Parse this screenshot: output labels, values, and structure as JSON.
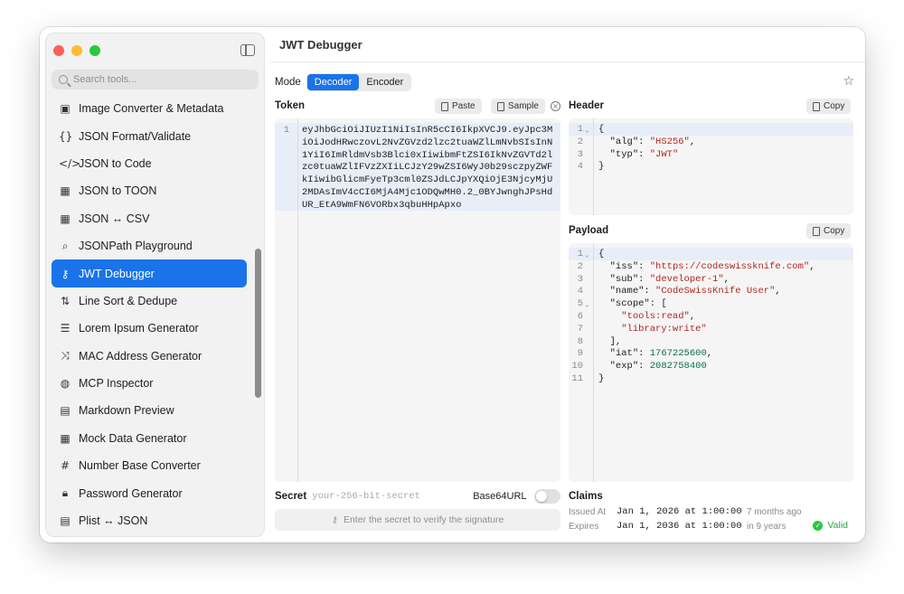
{
  "window": {
    "title": "JWT Debugger"
  },
  "sidebar": {
    "search_placeholder": "Search tools...",
    "items": [
      {
        "label": "Image Converter & Metadata",
        "icon": "image-icon",
        "glyph": "▣"
      },
      {
        "label": "JSON Format/Validate",
        "icon": "braces-icon",
        "glyph": "{}"
      },
      {
        "label": "JSON to Code",
        "icon": "code-icon",
        "glyph": "</>"
      },
      {
        "label": "JSON to TOON",
        "icon": "table-icon",
        "glyph": "▦"
      },
      {
        "label": "JSON ↔ CSV",
        "icon": "table-icon",
        "glyph": "▦"
      },
      {
        "label": "JSONPath Playground",
        "icon": "magnifier-icon",
        "glyph": "⌕"
      },
      {
        "label": "JWT Debugger",
        "icon": "key-icon",
        "glyph": "⚷"
      },
      {
        "label": "Line Sort & Dedupe",
        "icon": "sort-arrows-icon",
        "glyph": "⇅"
      },
      {
        "label": "Lorem Ipsum Generator",
        "icon": "text-lines-icon",
        "glyph": "☰"
      },
      {
        "label": "MAC Address Generator",
        "icon": "shuffle-icon",
        "glyph": "⤨"
      },
      {
        "label": "MCP Inspector",
        "icon": "globe-icon",
        "glyph": "◍"
      },
      {
        "label": "Markdown Preview",
        "icon": "document-icon",
        "glyph": "▤"
      },
      {
        "label": "Mock Data Generator",
        "icon": "table-icon",
        "glyph": "▦"
      },
      {
        "label": "Number Base Converter",
        "icon": "hash-icon",
        "glyph": "#"
      },
      {
        "label": "Password Generator",
        "icon": "lock-icon",
        "glyph": "🔒︎"
      },
      {
        "label": "Plist ↔ JSON",
        "icon": "list-icon",
        "glyph": "▤"
      }
    ]
  },
  "mode": {
    "label": "Mode",
    "options": [
      "Decoder",
      "Encoder"
    ],
    "selected": "Decoder"
  },
  "token": {
    "label": "Token",
    "paste_label": "Paste",
    "sample_label": "Sample",
    "line_number": "1",
    "value": "eyJhbGciOiJIUzI1NiIsInR5cCI6IkpXVCJ9.eyJpc3MiOiJodHRwczovL2NvZGVzd2lzc2tuaWZlLmNvbSIsInN1YiI6ImRldmVsb3Blci0xIiwibmFtZSI6IkNvZGVTd2lzc0tuaWZlIFVzZXIiLCJzY29wZSI6WyJ0b29sczpyZWFkIiwibGlicmFyeTp3cml0ZSJdLCJpYXQiOjE3NjcyMjU2MDAsImV4cCI6MjA4Mjc1ODQwMH0.2_0BYJwnghJPsHdUR_EtA9WmFN6VORbx3qbuHHpApxo"
  },
  "header": {
    "label": "Header",
    "copy_label": "Copy",
    "lines": [
      "{",
      "  \"alg\": \"HS256\",",
      "  \"typ\": \"JWT\"",
      "}"
    ]
  },
  "payload": {
    "label": "Payload",
    "copy_label": "Copy",
    "lines": [
      "{",
      "  \"iss\": \"https://codeswissknife.com\",",
      "  \"sub\": \"developer-1\",",
      "  \"name\": \"CodeSwissKnife User\",",
      "  \"scope\": [",
      "    \"tools:read\",",
      "    \"library:write\"",
      "  ],",
      "  \"iat\": 1767225600,",
      "  \"exp\": 2082758400",
      "}"
    ]
  },
  "secret": {
    "label": "Secret",
    "placeholder": "your-256-bit-secret",
    "base64url_label": "Base64URL",
    "verify_label": "Enter the secret to verify the signature"
  },
  "claims": {
    "label": "Claims",
    "issued_label": "Issued At",
    "issued_value": "Jan 1, 2026 at 1:00:00",
    "issued_relative": "7 months ago",
    "expires_label": "Expires",
    "expires_value": "Jan 1, 2036 at 1:00:00",
    "expires_relative": "in 9 years",
    "status": "Valid"
  },
  "colors": {
    "accent": "#1a73e8",
    "valid": "#28c840",
    "string": "#b3261e",
    "number": "#0b6e4f"
  }
}
